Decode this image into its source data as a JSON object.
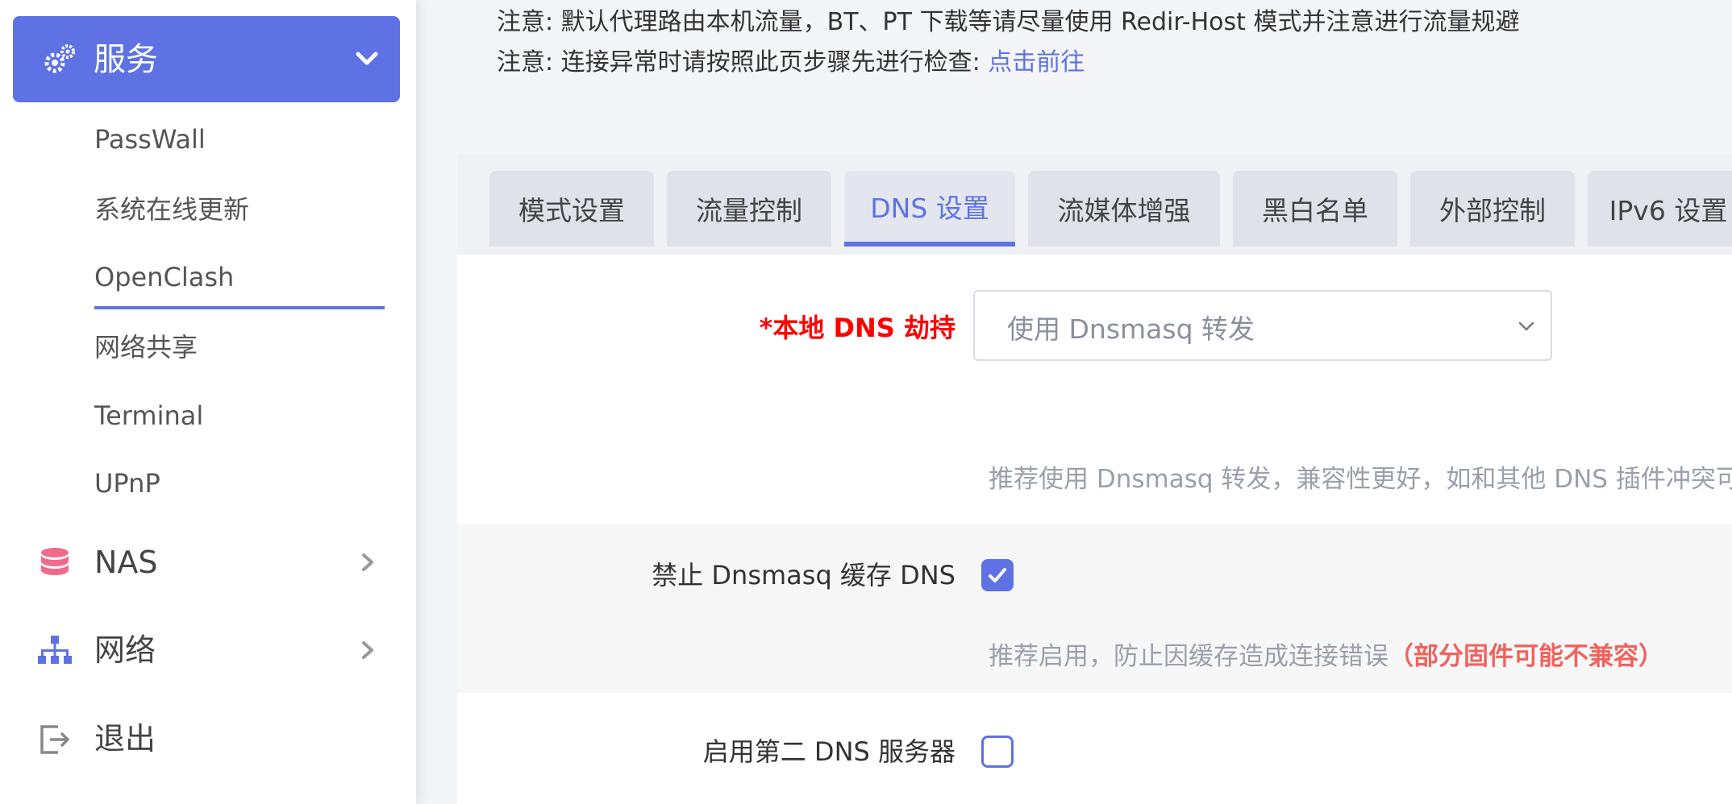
{
  "sidebar": {
    "active_menu": {
      "label": "服务",
      "icon": "gears-icon"
    },
    "sub_items": [
      {
        "label": "PassWall"
      },
      {
        "label": "系统在线更新"
      },
      {
        "label": "OpenClash",
        "selected": true
      },
      {
        "label": "网络共享"
      },
      {
        "label": "Terminal"
      },
      {
        "label": "UPnP"
      }
    ],
    "menu_items": [
      {
        "label": "NAS",
        "icon": "database-icon",
        "has_submenu": true
      },
      {
        "label": "网络",
        "icon": "network-icon",
        "has_submenu": true
      },
      {
        "label": "退出",
        "icon": "logout-icon",
        "has_submenu": false
      }
    ]
  },
  "notices": {
    "line1": "注意: 默认代理路由本机流量，BT、PT 下载等请尽量使用 Redir-Host 模式并注意进行流量规避",
    "line2_prefix": "注意: 连接异常时请按照此页步骤先进行检查: ",
    "line2_link": "点击前往"
  },
  "tabs": [
    {
      "label": "模式设置"
    },
    {
      "label": "流量控制"
    },
    {
      "label": "DNS 设置",
      "active": true
    },
    {
      "label": "流媒体增强"
    },
    {
      "label": "黑白名单"
    },
    {
      "label": "外部控制"
    },
    {
      "label": "IPv6 设置"
    }
  ],
  "form": {
    "dns_hijack": {
      "label": "*本地 DNS 劫持",
      "value": "使用 Dnsmasq 转发",
      "hint": "推荐使用 Dnsmasq 转发，兼容性更好，如和其他 DNS 插件冲突可"
    },
    "disable_cache": {
      "label": "禁止 Dnsmasq 缓存 DNS",
      "checked": true,
      "hint": "推荐启用，防止因缓存造成连接错误",
      "hint_warning": "（部分固件可能不兼容）"
    },
    "second_dns": {
      "label": "启用第二 DNS 服务器",
      "checked": false
    }
  },
  "colors": {
    "accent": "#5e72e4",
    "required": "#ff0000",
    "warning": "#f0635c"
  }
}
